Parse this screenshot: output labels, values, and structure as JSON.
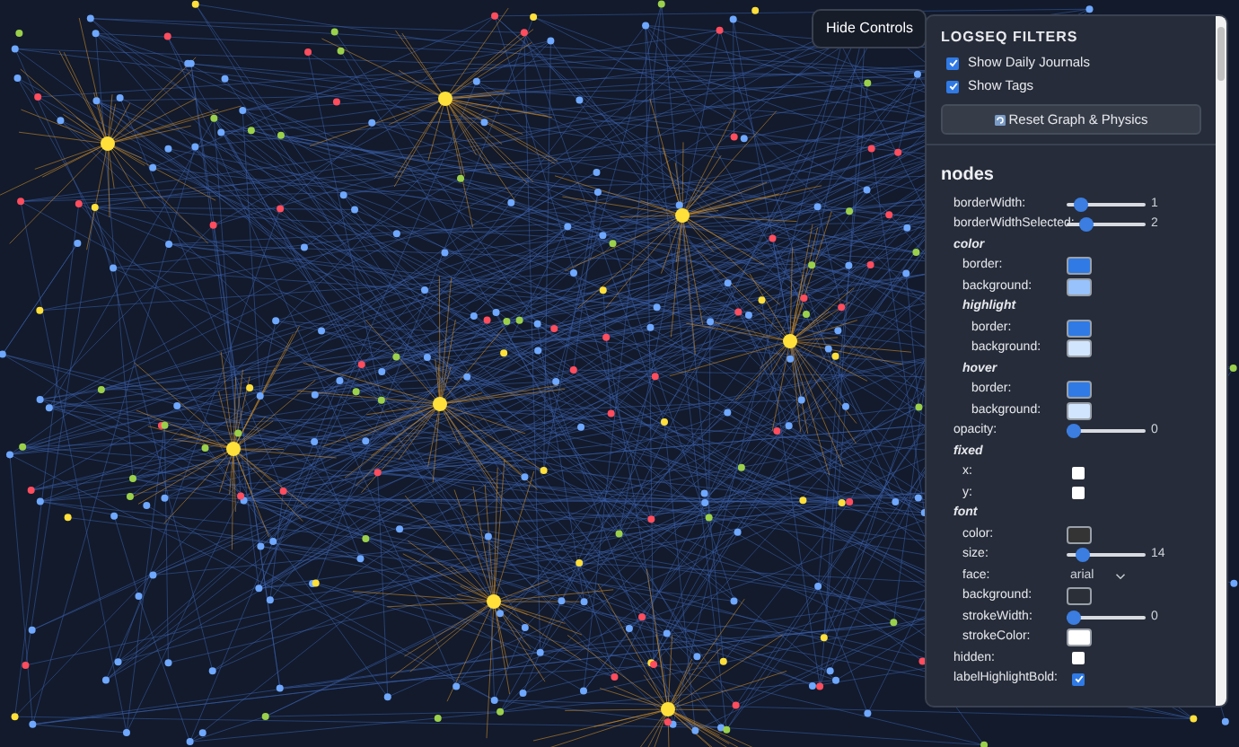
{
  "hide_controls_button": "Hide Controls",
  "filters": {
    "title": "LOGSEQ FILTERS",
    "options": [
      {
        "label": "Show Daily Journals",
        "checked": true
      },
      {
        "label": "Show Tags",
        "checked": true
      }
    ],
    "reset_button": "Reset Graph & Physics"
  },
  "section": {
    "title": "nodes",
    "rows": [
      {
        "kind": "slider",
        "label": "borderWidth:",
        "level": 0.12,
        "reading": "1"
      },
      {
        "kind": "slider",
        "label": "borderWidthSelected:",
        "level": 0.2,
        "reading": "2"
      },
      {
        "kind": "group",
        "label": "color",
        "children": [
          {
            "kind": "color",
            "label": "border:",
            "color": "#2f7ae5"
          },
          {
            "kind": "color",
            "label": "background:",
            "color": "#97c2fc"
          },
          {
            "kind": "group",
            "label": "highlight",
            "children": [
              {
                "kind": "color",
                "label": "border:",
                "color": "#2f7ae5"
              },
              {
                "kind": "color",
                "label": "background:",
                "color": "#d2e5ff"
              }
            ]
          },
          {
            "kind": "group",
            "label": "hover",
            "children": [
              {
                "kind": "color",
                "label": "border:",
                "color": "#2f7ae5"
              },
              {
                "kind": "color",
                "label": "background:",
                "color": "#d2e5ff"
              }
            ]
          }
        ]
      },
      {
        "kind": "slider",
        "label": "opacity:",
        "level": 0,
        "reading": "0"
      },
      {
        "kind": "group",
        "label": "fixed",
        "children": [
          {
            "kind": "checkbox",
            "label": "x:",
            "checked": false
          },
          {
            "kind": "checkbox",
            "label": "y:",
            "checked": false
          }
        ]
      },
      {
        "kind": "group",
        "label": "font",
        "children": [
          {
            "kind": "color",
            "label": "color:",
            "color": "#343434"
          },
          {
            "kind": "slider",
            "label": "size:",
            "level": 0.15,
            "reading": "14"
          },
          {
            "kind": "select",
            "label": "face:",
            "value": "arial"
          },
          {
            "kind": "color",
            "label": "background:",
            "color": "#2b2f38"
          },
          {
            "kind": "slider",
            "label": "strokeWidth:",
            "level": 0,
            "reading": "0"
          },
          {
            "kind": "color",
            "label": "strokeColor:",
            "color": "#ffffff"
          }
        ]
      },
      {
        "kind": "checkbox",
        "label": "hidden:",
        "checked": false
      },
      {
        "kind": "checkbox",
        "label": "labelHighlightBold:",
        "checked": true
      }
    ]
  }
}
